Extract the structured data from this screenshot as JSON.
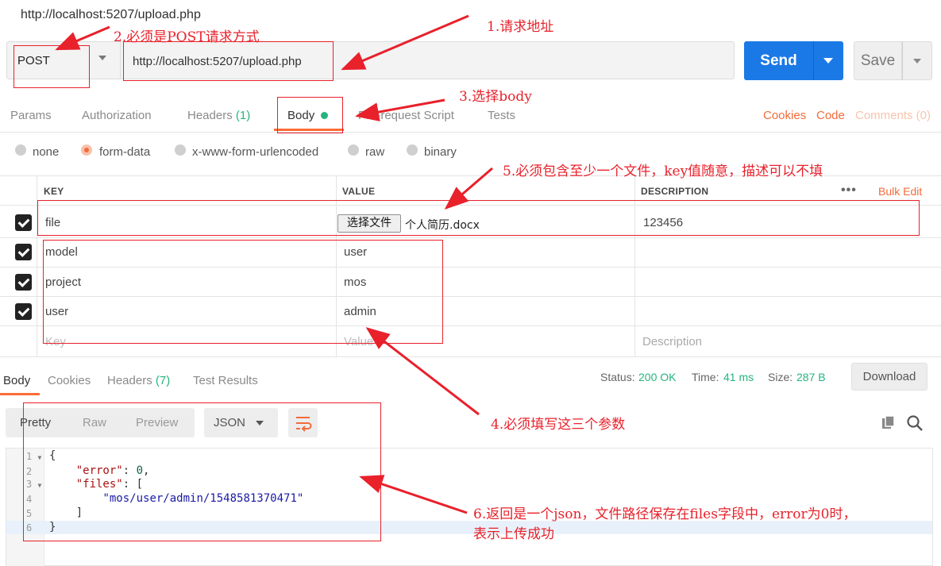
{
  "window": {
    "title": "http://localhost:5207/upload.php"
  },
  "request": {
    "method": "POST",
    "url": "http://localhost:5207/upload.php",
    "send_label": "Send",
    "save_label": "Save"
  },
  "request_tabs": {
    "params": "Params",
    "authorization": "Authorization",
    "headers": "Headers",
    "headers_count": "(1)",
    "body": "Body",
    "prerequest": "Pre-request Script",
    "tests": "Tests",
    "cookies": "Cookies",
    "code": "Code",
    "comments": "Comments (0)"
  },
  "body_types": {
    "none": "none",
    "form_data": "form-data",
    "urlencoded": "x-www-form-urlencoded",
    "raw": "raw",
    "binary": "binary",
    "selected": "form-data"
  },
  "params_table": {
    "headers": {
      "key": "KEY",
      "value": "VALUE",
      "description": "DESCRIPTION",
      "bulk_edit": "Bulk Edit"
    },
    "rows": [
      {
        "key": "file",
        "value_button": "选择文件",
        "value": "个人简历.docx",
        "description": "123456",
        "checked": true
      },
      {
        "key": "model",
        "value": "user",
        "description": "",
        "checked": true
      },
      {
        "key": "project",
        "value": "mos",
        "description": "",
        "checked": true
      },
      {
        "key": "user",
        "value": "admin",
        "description": "",
        "checked": true
      }
    ],
    "placeholder": {
      "key": "Key",
      "value": "Value",
      "description": "Description"
    }
  },
  "response": {
    "tabs": {
      "body": "Body",
      "cookies": "Cookies",
      "headers": "Headers",
      "headers_count": "(7)",
      "test_results": "Test Results"
    },
    "status_label": "Status:",
    "status_value": "200 OK",
    "time_label": "Time:",
    "time_value": "41 ms",
    "size_label": "Size:",
    "size_value": "287 B",
    "download_label": "Download",
    "view_modes": {
      "pretty": "Pretty",
      "raw": "Raw",
      "preview": "Preview"
    },
    "format": "JSON",
    "code": {
      "line_numbers": [
        "1",
        "2",
        "3",
        "4",
        "5",
        "6"
      ],
      "open_brace": "{",
      "error_key": "\"error\"",
      "error_value": "0",
      "files_key": "\"files\"",
      "open_bracket": "[",
      "file_path": "\"mos/user/admin/1548581370471\"",
      "close_bracket": "]",
      "close_brace": "}"
    }
  },
  "annotations": {
    "a1": "1.请求地址",
    "a2": "2.必须是POST请求方式",
    "a3": "3.选择body",
    "a4": "4.必须填写这三个参数",
    "a5": "5.必须包含至少一个文件，key值随意，描述可以不填",
    "a6_line1": "6.返回是一个json，文件路径保存在files字段中，error为0时，",
    "a6_line2": "表示上传成功"
  },
  "colors": {
    "send_blue": "#1b79e6",
    "accent_orange": "#ff6c37",
    "status_green": "#26b47f",
    "annotation_red": "#e8212b"
  },
  "icons": [
    "dropdown-caret-icon",
    "wrap-lines-icon",
    "copy-icon",
    "search-icon",
    "more-options-icon",
    "checkbox-checked-icon"
  ]
}
